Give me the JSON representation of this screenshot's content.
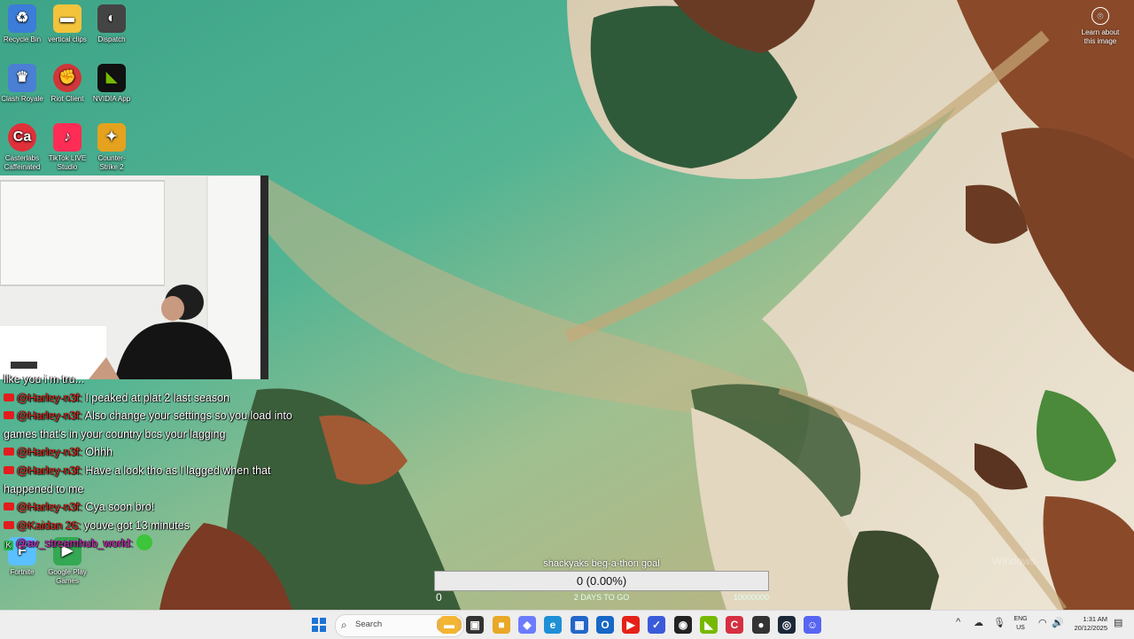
{
  "desktop": {
    "icons": [
      {
        "label": "Recycle Bin",
        "icon": "recycle-bin-icon",
        "color": "#3b7dd8"
      },
      {
        "label": "vertical clips",
        "icon": "folder-icon",
        "color": "#f3c33c"
      },
      {
        "label": "Dispatch",
        "icon": "dispatch-icon",
        "color": "#444444"
      },
      {
        "label": "Clash Royale",
        "icon": "clash-royale-icon",
        "color": "#4a7fd4"
      },
      {
        "label": "Riot Client",
        "icon": "riot-client-icon",
        "color": "#d13639"
      },
      {
        "label": "NVIDIA App",
        "icon": "nvidia-icon",
        "color": "#76b900"
      },
      {
        "label": "Casterlabs Caffeinated",
        "icon": "casterlabs-icon",
        "color": "#e0303a"
      },
      {
        "label": "TikTok LIVE Studio",
        "icon": "tiktok-icon",
        "color": "#ff2d55"
      },
      {
        "label": "Counter-Strike 2",
        "icon": "counter-strike-icon",
        "color": "#e5a21e"
      },
      {
        "label": "Fortnite",
        "icon": "fortnite-icon",
        "color": "#5bc0ff"
      },
      {
        "label": "Google Play Games",
        "icon": "google-play-games-icon",
        "color": "#34a853"
      }
    ],
    "learn_more": {
      "label": "Learn about this image",
      "icon": "camera-icon"
    }
  },
  "chat": {
    "partial_top": "like you i m tru...",
    "messages": [
      {
        "user": "@Harley-n3f:",
        "text": "I peaked at plat 2 last season"
      },
      {
        "user": "@Harley-n3f:",
        "text": "Also change your settings so you load into games that's in your country bcs your lagging"
      },
      {
        "user": "@Harley-n3f:",
        "text": "Ohhh"
      },
      {
        "user": "@Harley-n3f:",
        "text": "Have a look tho as I lagged when that happened to me"
      },
      {
        "user": "@Harley-n3f:",
        "text": "Cya soon bro!"
      },
      {
        "user": "@Kaidan 26:",
        "text": "youve got 13 minutes"
      },
      {
        "user": "@av_streamhub_world:",
        "text": ""
      }
    ]
  },
  "goal": {
    "title": "shackyaks beg-a-thon goal",
    "progress_label": "0 (0.00%)",
    "progress_fraction": 0,
    "min": "0",
    "days_left": "2 DAYS TO GO",
    "max": "10000000"
  },
  "watermark": "Windows",
  "taskbar": {
    "search_placeholder": "Search",
    "apps": [
      {
        "name": "file-explorer",
        "icon": "file-explorer-icon",
        "color": "#f2b632",
        "glyph": "▬"
      },
      {
        "name": "task-view",
        "icon": "task-view-icon",
        "color": "#333333",
        "glyph": "▣"
      },
      {
        "name": "folder",
        "icon": "folder-icon",
        "color": "#e9a825",
        "glyph": "■"
      },
      {
        "name": "copilot",
        "icon": "copilot-icon",
        "color": "#6b7cff",
        "glyph": "◆"
      },
      {
        "name": "edge",
        "icon": "edge-icon",
        "color": "#1f8fd6",
        "glyph": "e"
      },
      {
        "name": "store",
        "icon": "store-icon",
        "color": "#2367c9",
        "glyph": "▦"
      },
      {
        "name": "outlook",
        "icon": "outlook-icon",
        "color": "#1667c6",
        "glyph": "O"
      },
      {
        "name": "youtube",
        "icon": "youtube-icon",
        "color": "#e62117",
        "glyph": "▶"
      },
      {
        "name": "to-do",
        "icon": "to-do-icon",
        "color": "#3a5bd9",
        "glyph": "✓"
      },
      {
        "name": "obs",
        "icon": "obs-icon",
        "color": "#222222",
        "glyph": "◉"
      },
      {
        "name": "nvidia",
        "icon": "nvidia-icon",
        "color": "#76b900",
        "glyph": "◣"
      },
      {
        "name": "casterlabs",
        "icon": "casterlabs-icon",
        "color": "#d63040",
        "glyph": "C"
      },
      {
        "name": "app-red-dot",
        "icon": "chrome-icon",
        "color": "#333333",
        "glyph": "●"
      },
      {
        "name": "steam",
        "icon": "steam-icon",
        "color": "#1b2838",
        "glyph": "◎"
      },
      {
        "name": "discord",
        "icon": "discord-icon",
        "color": "#5865f2",
        "glyph": "☺"
      }
    ],
    "tray": {
      "chevron": "^",
      "lang_top": "ENG",
      "lang_bottom": "US",
      "time": "1:31 AM",
      "date": "20/12/2025"
    }
  }
}
